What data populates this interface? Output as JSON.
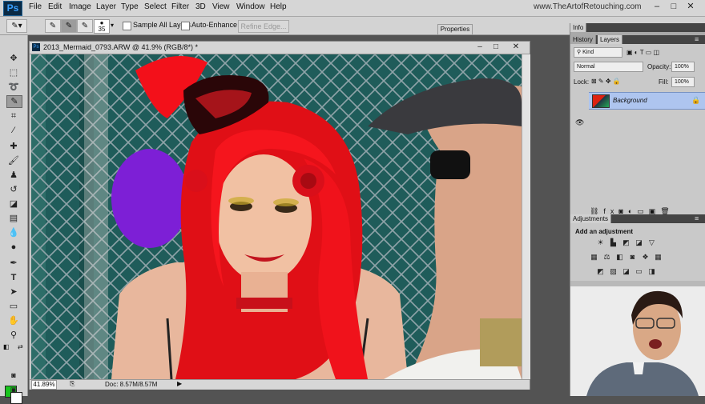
{
  "app": {
    "logo": "Ps",
    "menus": [
      "File",
      "Edit",
      "Image",
      "Layer",
      "Type",
      "Select",
      "Filter",
      "3D",
      "View",
      "Window",
      "Help"
    ],
    "watermark": "www.TheArtofRetouching.com"
  },
  "window_controls": {
    "minimize": "–",
    "maximize": "□",
    "close": "✕"
  },
  "options": {
    "brush_size": "35",
    "sample_all_layers": "Sample All Layers",
    "auto_enhance": "Auto-Enhance",
    "refine_edge": "Refine Edge..."
  },
  "tools": [
    "move-icon",
    "marquee-icon",
    "lasso-icon",
    "quick-selection-icon",
    "crop-icon",
    "eyedropper-icon",
    "healing-brush-icon",
    "brush-icon",
    "clone-stamp-icon",
    "history-brush-icon",
    "eraser-icon",
    "gradient-icon",
    "blur-icon",
    "dodge-icon",
    "pen-icon",
    "type-icon",
    "path-selection-icon",
    "shape-icon",
    "hand-icon",
    "zoom-icon"
  ],
  "colors": {
    "foreground": "#19c41e",
    "background": "#ffffff",
    "selection": "#aec5ef"
  },
  "document": {
    "title": "2013_Mermaid_0793.ARW @ 41.9% (RGB/8*) *",
    "zoom": "41.89%",
    "doc_size": "Doc: 8.57M/8.57M"
  },
  "properties_tab": "Properties",
  "panels": {
    "info_tab": "Info",
    "history_tab": "History",
    "layers_tab": "Layers",
    "kind_label": "Kind",
    "blend_mode": "Normal",
    "opacity_label": "Opacity:",
    "opacity_value": "100%",
    "lock_label": "Lock:",
    "fill_label": "Fill:",
    "fill_value": "100%",
    "layer_name": "Background",
    "adjustments_tab": "Adjustments",
    "add_adjustment": "Add an adjustment"
  }
}
